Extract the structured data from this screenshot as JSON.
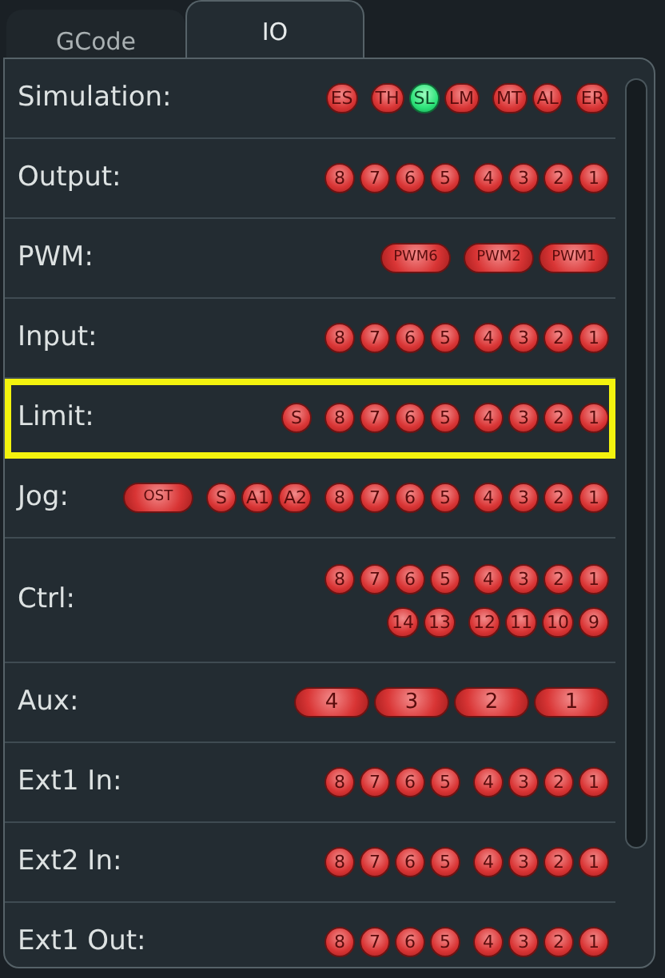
{
  "tabs": [
    {
      "label": "GCode",
      "selected": false
    },
    {
      "label": "IO",
      "selected": true
    }
  ],
  "rows": [
    {
      "label": "Simulation:",
      "highlighted": false,
      "lines": [
        [
          [
            {
              "kind": "round",
              "text": "ES",
              "on": false
            }
          ],
          [
            {
              "kind": "round",
              "text": "TH",
              "on": false
            },
            {
              "kind": "round",
              "text": "SL",
              "on": true
            },
            {
              "kind": "round",
              "text": "LM",
              "on": false
            }
          ],
          [
            {
              "kind": "round",
              "text": "MT",
              "on": false
            },
            {
              "kind": "round",
              "text": "AL",
              "on": false
            }
          ],
          [
            {
              "kind": "round",
              "text": "ER",
              "on": false
            }
          ]
        ]
      ]
    },
    {
      "label": "Output:",
      "highlighted": false,
      "lines": [
        [
          [
            {
              "kind": "round",
              "text": "8",
              "on": false
            },
            {
              "kind": "round",
              "text": "7",
              "on": false
            },
            {
              "kind": "round",
              "text": "6",
              "on": false
            },
            {
              "kind": "round",
              "text": "5",
              "on": false
            }
          ],
          [
            {
              "kind": "round",
              "text": "4",
              "on": false
            },
            {
              "kind": "round",
              "text": "3",
              "on": false
            },
            {
              "kind": "round",
              "text": "2",
              "on": false
            },
            {
              "kind": "round",
              "text": "1",
              "on": false
            }
          ]
        ]
      ]
    },
    {
      "label": "PWM:",
      "highlighted": false,
      "lines": [
        [
          [
            {
              "kind": "pill",
              "text": "PWM6",
              "on": false
            }
          ],
          [
            {
              "kind": "pill",
              "text": "PWM2",
              "on": false
            },
            {
              "kind": "pill",
              "text": "PWM1",
              "on": false
            }
          ]
        ]
      ]
    },
    {
      "label": "Input:",
      "highlighted": false,
      "lines": [
        [
          [
            {
              "kind": "round",
              "text": "8",
              "on": false
            },
            {
              "kind": "round",
              "text": "7",
              "on": false
            },
            {
              "kind": "round",
              "text": "6",
              "on": false
            },
            {
              "kind": "round",
              "text": "5",
              "on": false
            }
          ],
          [
            {
              "kind": "round",
              "text": "4",
              "on": false
            },
            {
              "kind": "round",
              "text": "3",
              "on": false
            },
            {
              "kind": "round",
              "text": "2",
              "on": false
            },
            {
              "kind": "round",
              "text": "1",
              "on": false
            }
          ]
        ]
      ]
    },
    {
      "label": "Limit:",
      "highlighted": true,
      "lines": [
        [
          [
            {
              "kind": "round",
              "text": "S",
              "on": false
            }
          ],
          [
            {
              "kind": "round",
              "text": "8",
              "on": false
            },
            {
              "kind": "round",
              "text": "7",
              "on": false
            },
            {
              "kind": "round",
              "text": "6",
              "on": false
            },
            {
              "kind": "round",
              "text": "5",
              "on": false
            }
          ],
          [
            {
              "kind": "round",
              "text": "4",
              "on": false
            },
            {
              "kind": "round",
              "text": "3",
              "on": false
            },
            {
              "kind": "round",
              "text": "2",
              "on": false
            },
            {
              "kind": "round",
              "text": "1",
              "on": false
            }
          ]
        ]
      ]
    },
    {
      "label": "Jog:",
      "highlighted": false,
      "lines": [
        [
          [
            {
              "kind": "pill",
              "text": "OST",
              "on": false
            }
          ],
          [
            {
              "kind": "round",
              "text": "S",
              "on": false
            },
            {
              "kind": "round",
              "text": "A1",
              "on": false
            },
            {
              "kind": "round",
              "text": "A2",
              "on": false
            }
          ],
          [
            {
              "kind": "round",
              "text": "8",
              "on": false
            },
            {
              "kind": "round",
              "text": "7",
              "on": false
            },
            {
              "kind": "round",
              "text": "6",
              "on": false
            },
            {
              "kind": "round",
              "text": "5",
              "on": false
            }
          ],
          [
            {
              "kind": "round",
              "text": "4",
              "on": false
            },
            {
              "kind": "round",
              "text": "3",
              "on": false
            },
            {
              "kind": "round",
              "text": "2",
              "on": false
            },
            {
              "kind": "round",
              "text": "1",
              "on": false
            }
          ]
        ]
      ]
    },
    {
      "label": "Ctrl:",
      "highlighted": false,
      "lines": [
        [
          [
            {
              "kind": "round",
              "text": "8",
              "on": false
            },
            {
              "kind": "round",
              "text": "7",
              "on": false
            },
            {
              "kind": "round",
              "text": "6",
              "on": false
            },
            {
              "kind": "round",
              "text": "5",
              "on": false
            }
          ],
          [
            {
              "kind": "round",
              "text": "4",
              "on": false
            },
            {
              "kind": "round",
              "text": "3",
              "on": false
            },
            {
              "kind": "round",
              "text": "2",
              "on": false
            },
            {
              "kind": "round",
              "text": "1",
              "on": false
            }
          ]
        ],
        [
          [
            {
              "kind": "round",
              "text": "14",
              "on": false
            },
            {
              "kind": "round",
              "text": "13",
              "on": false
            }
          ],
          [
            {
              "kind": "round",
              "text": "12",
              "on": false
            },
            {
              "kind": "round",
              "text": "11",
              "on": false
            },
            {
              "kind": "round",
              "text": "10",
              "on": false
            },
            {
              "kind": "round",
              "text": "9",
              "on": false
            }
          ]
        ]
      ]
    },
    {
      "label": "Aux:",
      "highlighted": false,
      "lines": [
        [
          [
            {
              "kind": "wide",
              "text": "4",
              "on": false
            },
            {
              "kind": "wide",
              "text": "3",
              "on": false
            },
            {
              "kind": "wide",
              "text": "2",
              "on": false
            },
            {
              "kind": "wide",
              "text": "1",
              "on": false
            }
          ]
        ]
      ]
    },
    {
      "label": "Ext1 In:",
      "highlighted": false,
      "lines": [
        [
          [
            {
              "kind": "round",
              "text": "8",
              "on": false
            },
            {
              "kind": "round",
              "text": "7",
              "on": false
            },
            {
              "kind": "round",
              "text": "6",
              "on": false
            },
            {
              "kind": "round",
              "text": "5",
              "on": false
            }
          ],
          [
            {
              "kind": "round",
              "text": "4",
              "on": false
            },
            {
              "kind": "round",
              "text": "3",
              "on": false
            },
            {
              "kind": "round",
              "text": "2",
              "on": false
            },
            {
              "kind": "round",
              "text": "1",
              "on": false
            }
          ]
        ]
      ]
    },
    {
      "label": "Ext2 In:",
      "highlighted": false,
      "lines": [
        [
          [
            {
              "kind": "round",
              "text": "8",
              "on": false
            },
            {
              "kind": "round",
              "text": "7",
              "on": false
            },
            {
              "kind": "round",
              "text": "6",
              "on": false
            },
            {
              "kind": "round",
              "text": "5",
              "on": false
            }
          ],
          [
            {
              "kind": "round",
              "text": "4",
              "on": false
            },
            {
              "kind": "round",
              "text": "3",
              "on": false
            },
            {
              "kind": "round",
              "text": "2",
              "on": false
            },
            {
              "kind": "round",
              "text": "1",
              "on": false
            }
          ]
        ]
      ]
    },
    {
      "label": "Ext1 Out:",
      "highlighted": false,
      "lines": [
        [
          [
            {
              "kind": "round",
              "text": "8",
              "on": false
            },
            {
              "kind": "round",
              "text": "7",
              "on": false
            },
            {
              "kind": "round",
              "text": "6",
              "on": false
            },
            {
              "kind": "round",
              "text": "5",
              "on": false
            }
          ],
          [
            {
              "kind": "round",
              "text": "4",
              "on": false
            },
            {
              "kind": "round",
              "text": "3",
              "on": false
            },
            {
              "kind": "round",
              "text": "2",
              "on": false
            },
            {
              "kind": "round",
              "text": "1",
              "on": false
            }
          ]
        ]
      ]
    }
  ]
}
